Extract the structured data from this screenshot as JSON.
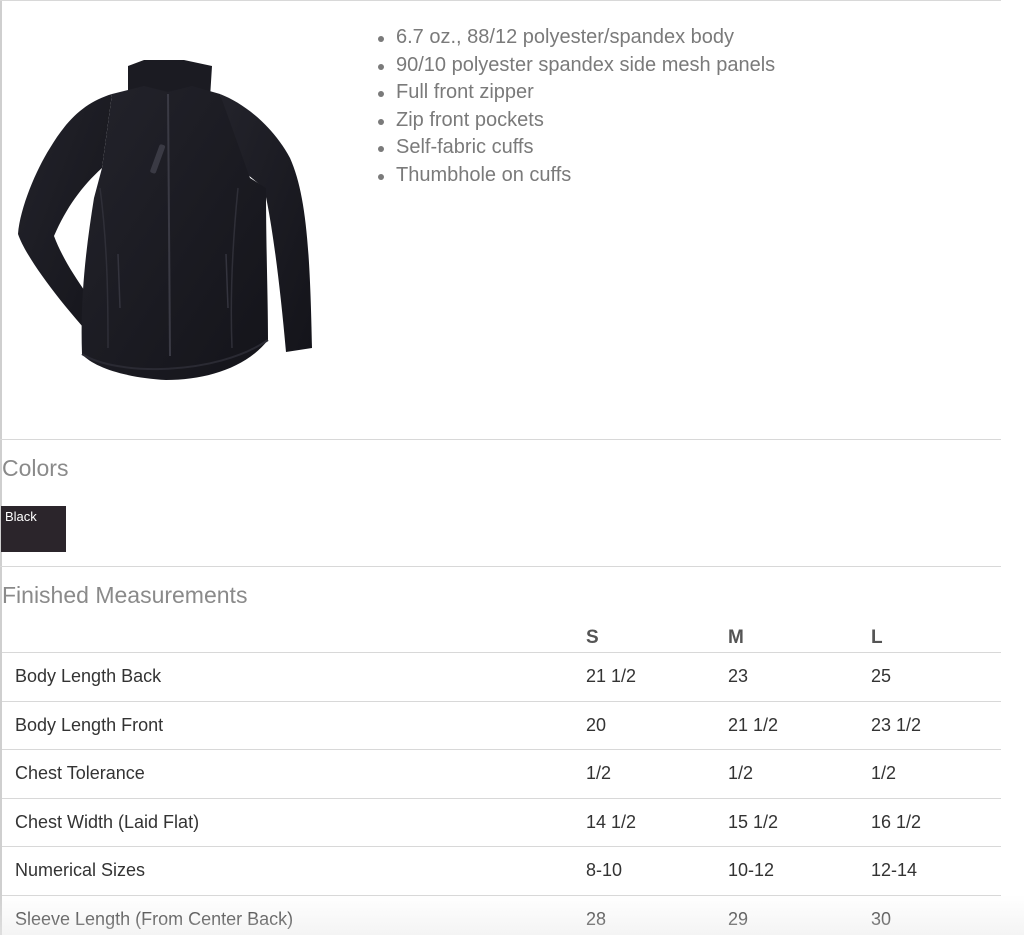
{
  "product": {
    "image_icon": "jacket-image",
    "features": [
      "6.7 oz., 88/12 polyester/spandex body",
      "90/10 polyester spandex side mesh panels",
      "Full front zipper",
      "Zip front pockets",
      "Self-fabric cuffs",
      "Thumbhole on cuffs"
    ]
  },
  "colors": {
    "title": "Colors",
    "swatches": [
      {
        "label": "Black",
        "color": "#2b252b"
      }
    ]
  },
  "measurements": {
    "title": "Finished Measurements",
    "columns": [
      "",
      "S",
      "M",
      "L"
    ],
    "rows": [
      {
        "label": "Body Length Back",
        "values": [
          "21 1/2",
          "23",
          "25"
        ]
      },
      {
        "label": "Body Length Front",
        "values": [
          "20",
          "21 1/2",
          "23 1/2"
        ]
      },
      {
        "label": "Chest Tolerance",
        "values": [
          "1/2",
          "1/2",
          "1/2"
        ]
      },
      {
        "label": "Chest Width (Laid Flat)",
        "values": [
          "14 1/2",
          "15 1/2",
          "16 1/2"
        ]
      },
      {
        "label": "Numerical Sizes",
        "values": [
          "8-10",
          "10-12",
          "12-14"
        ]
      },
      {
        "label": "Sleeve Length (From Center Back)",
        "values": [
          "28",
          "29",
          "30"
        ]
      }
    ]
  }
}
